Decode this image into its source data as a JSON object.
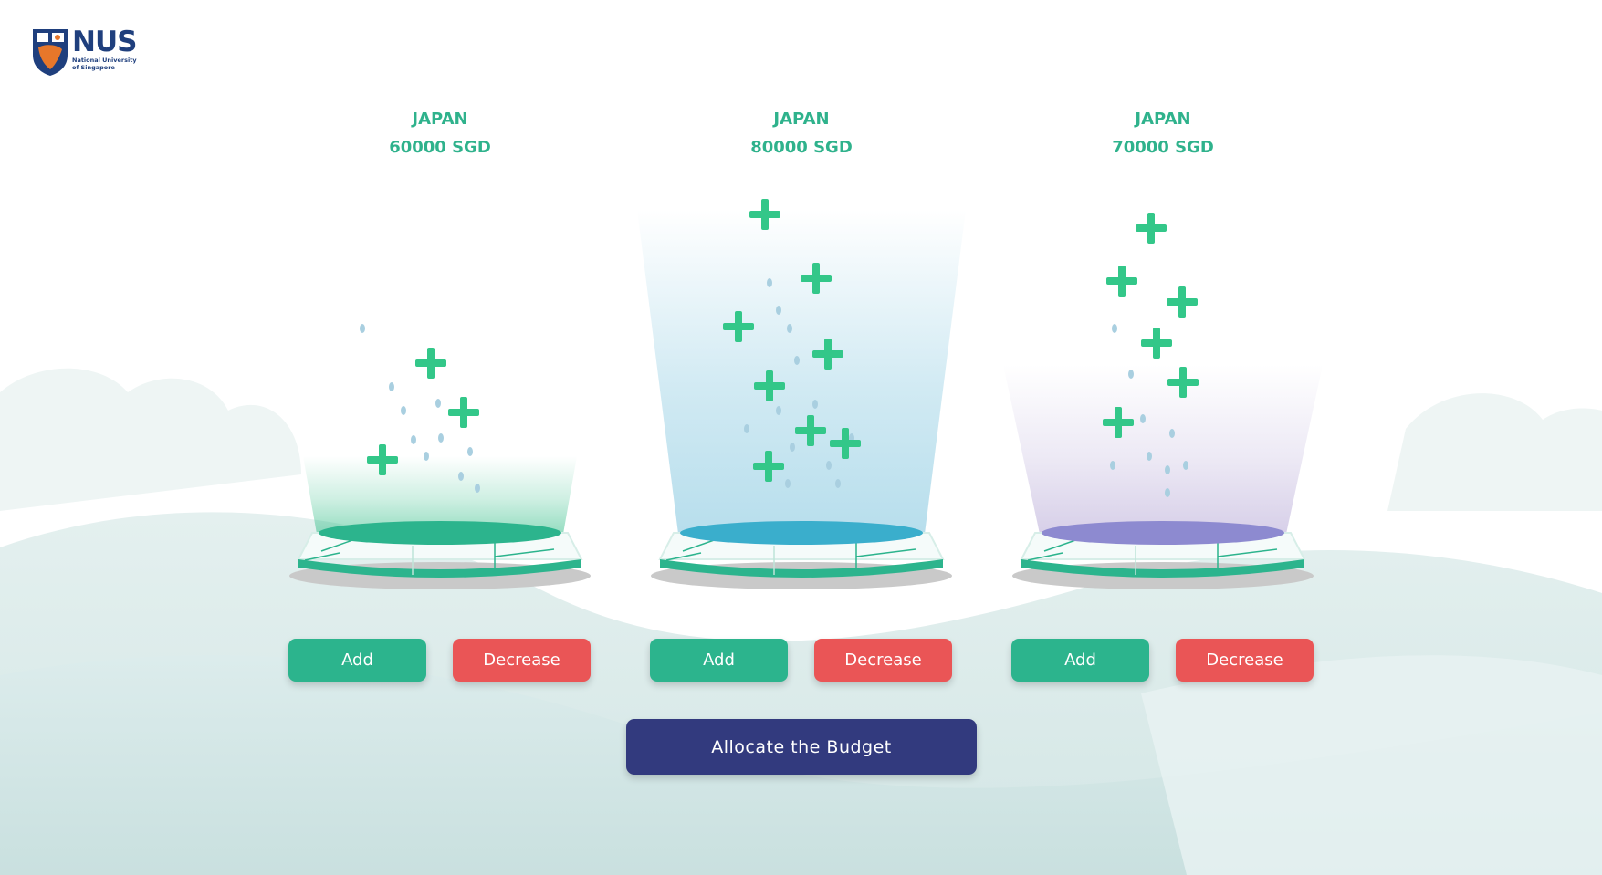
{
  "brand": {
    "logo_name": "NUS",
    "logo_line1": "National University",
    "logo_line2": "of Singapore"
  },
  "stations": [
    {
      "country": "JAPAN",
      "amount": "60000 SGD",
      "add_label": "Add",
      "decrease_label": "Decrease",
      "beam_color": "#3ec18e",
      "pad_color": "#2cb48d"
    },
    {
      "country": "JAPAN",
      "amount": "80000 SGD",
      "add_label": "Add",
      "decrease_label": "Decrease",
      "beam_color": "#7cc3dd",
      "pad_color": "#3aaecc"
    },
    {
      "country": "JAPAN",
      "amount": "70000 SGD",
      "add_label": "Add",
      "decrease_label": "Decrease",
      "beam_color": "#b6a8d6",
      "pad_color": "#8d8ad0"
    }
  ],
  "allocate_label": "Allocate the Budget",
  "colors": {
    "text_accent": "#2fb28c",
    "add_button": "#2cb48d",
    "decrease_button": "#ea5556",
    "allocate_button": "#323a7e",
    "plus_icon": "#33c789"
  }
}
